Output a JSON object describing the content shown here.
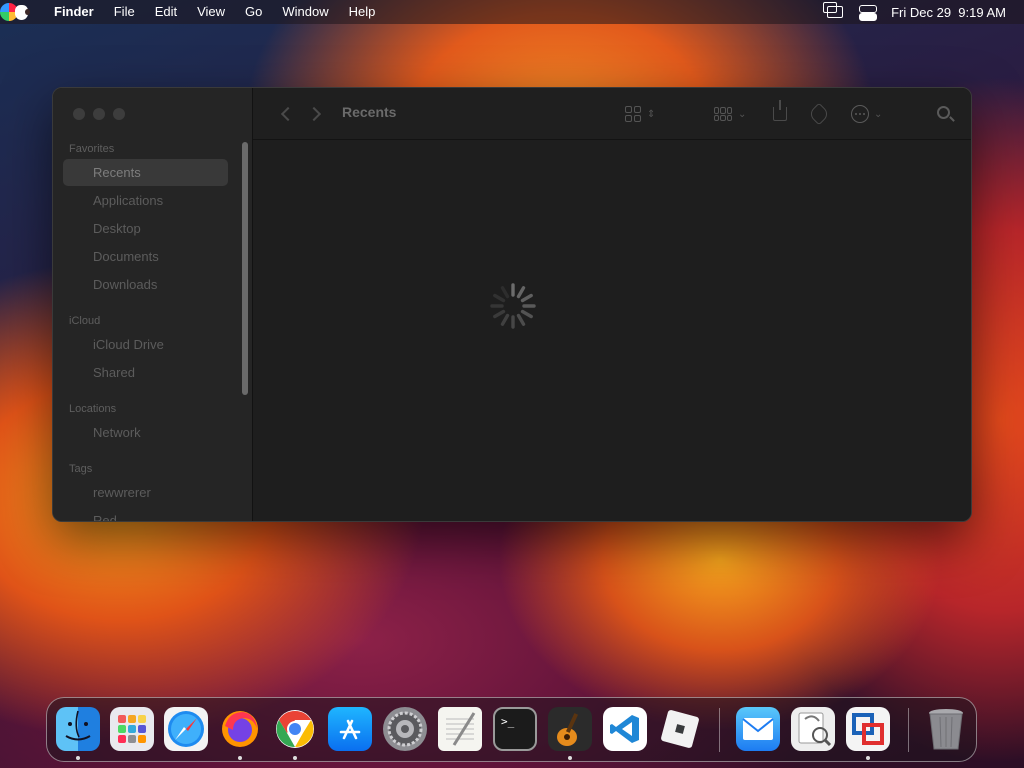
{
  "menubar": {
    "app_name": "Finder",
    "menus": [
      "File",
      "Edit",
      "View",
      "Go",
      "Window",
      "Help"
    ],
    "datetime": "Fri Dec 29  9:19 AM"
  },
  "finder": {
    "title": "Recents",
    "sidebar": {
      "favorites_label": "Favorites",
      "favorites": [
        "Recents",
        "Applications",
        "Desktop",
        "Documents",
        "Downloads"
      ],
      "icloud_label": "iCloud",
      "icloud": [
        "iCloud Drive",
        "Shared"
      ],
      "locations_label": "Locations",
      "locations": [
        "Network"
      ],
      "tags_label": "Tags",
      "tags": [
        "rewwrerer",
        "Red"
      ]
    },
    "status": "loading"
  },
  "dock": {
    "apps": [
      {
        "name": "Finder",
        "icon": "finder-icon",
        "running": true
      },
      {
        "name": "Launchpad",
        "icon": "launchpad-icon",
        "running": false
      },
      {
        "name": "Safari",
        "icon": "safari-icon",
        "running": false
      },
      {
        "name": "Firefox",
        "icon": "firefox-icon",
        "running": true
      },
      {
        "name": "Chrome",
        "icon": "chrome-icon",
        "running": true
      },
      {
        "name": "App Store",
        "icon": "app-store-icon",
        "running": false
      },
      {
        "name": "System Settings",
        "icon": "settings-icon",
        "running": false
      },
      {
        "name": "TextEdit",
        "icon": "textedit-icon",
        "running": false
      },
      {
        "name": "Terminal",
        "icon": "terminal-icon",
        "running": false
      },
      {
        "name": "GarageBand",
        "icon": "garageband-icon",
        "running": true
      },
      {
        "name": "VS Code",
        "icon": "vscode-icon",
        "running": false
      },
      {
        "name": "Roblox",
        "icon": "roblox-icon",
        "running": false
      },
      {
        "name": "Mail",
        "icon": "mail-icon",
        "running": false
      },
      {
        "name": "Preview",
        "icon": "preview-icon",
        "running": false
      },
      {
        "name": "VMware Fusion",
        "icon": "vmware-icon",
        "running": true
      },
      {
        "name": "Trash",
        "icon": "trash-icon",
        "running": false
      }
    ]
  }
}
